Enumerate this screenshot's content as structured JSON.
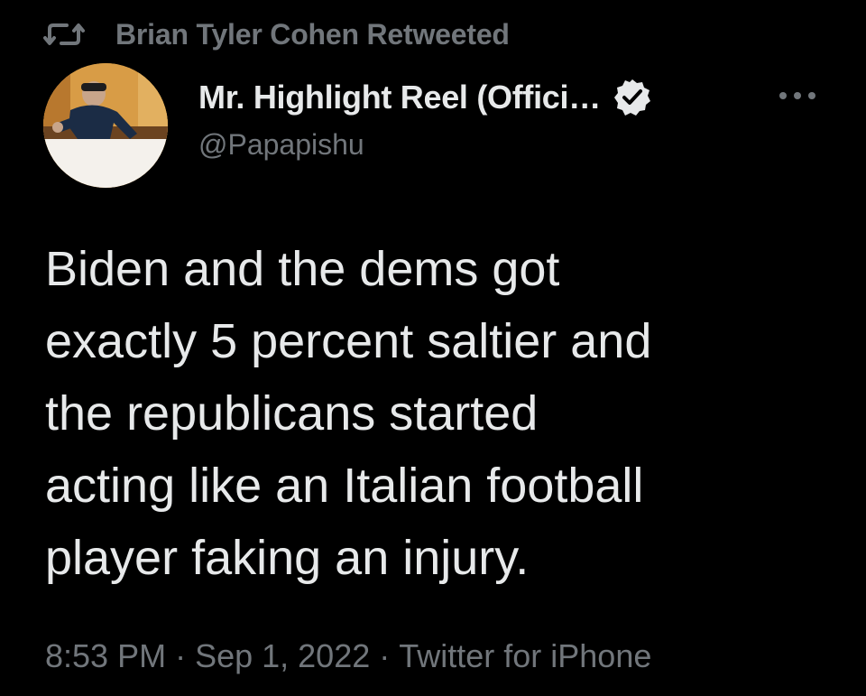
{
  "retweet": {
    "icon": "retweet-icon",
    "label": "Brian Tyler Cohen Retweeted"
  },
  "author": {
    "avatar_icon": "profile-avatar",
    "display_name": "Mr. Highlight Reel (Offici…",
    "verified_icon": "verified-badge-icon",
    "handle": "@Papapishu"
  },
  "more_icon": "more-options-icon",
  "tweet": {
    "lines": [
      "Biden and the dems got",
      "exactly 5 percent saltier and",
      "the republicans started",
      "acting like an Italian football",
      "player faking an injury."
    ]
  },
  "meta": {
    "time": "8:53 PM",
    "separator": "·",
    "date": "Sep 1, 2022",
    "source": "Twitter for iPhone"
  },
  "colors": {
    "background": "#000000",
    "primary_text": "#e7e9ea",
    "secondary_text": "#71767b"
  }
}
